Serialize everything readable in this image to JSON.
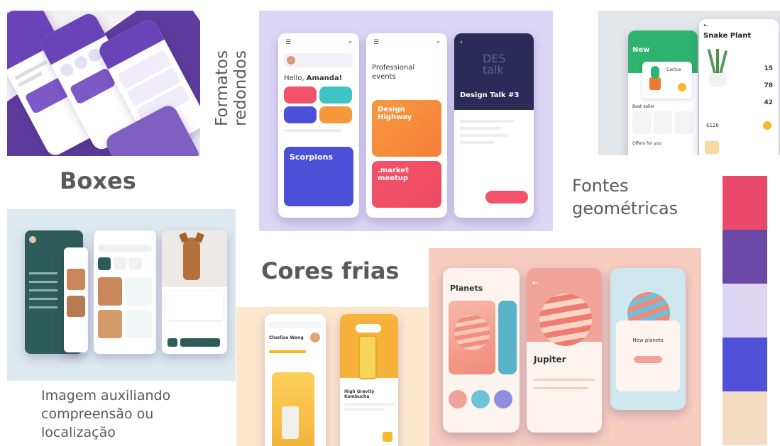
{
  "labels": {
    "formatos_line1": "Formatos",
    "formatos_line2": "redondos",
    "boxes": "Boxes",
    "fontes_line1": "Fontes",
    "fontes_line2": "geométricas",
    "cores_frias": "Cores frias",
    "imagem_line1": "Imagem auxiliando",
    "imagem_line2": "compreensão ou",
    "imagem_line3": "localização"
  },
  "events_app": {
    "hello_prefix": "Hello, ",
    "hello_name": "Amanda!",
    "scorpions": "Scorpions",
    "professional": "Professional",
    "events": "events",
    "design_highway": "Design Highway",
    "market_meetup": ".market meetup",
    "des": "DES",
    "talk": "talk",
    "design_talk": "Design Talk #3"
  },
  "plant_app": {
    "new_tab": "New",
    "cactus": "Cactus",
    "best_seller": "Best seller",
    "offers": "Offers for you",
    "snake_plant": "Snake Plant",
    "stat1": "15",
    "stat2": "78",
    "stat3": "42",
    "price": "$126"
  },
  "drink_app": {
    "user_name": "Charlise Wong",
    "product": "High Gravity Kombucha"
  },
  "planet_app": {
    "planets_title": "Planets",
    "jupiter": "Jupiter",
    "new_planets": "New planets"
  },
  "palette": [
    "#e94a6a",
    "#6a4aa6",
    "#dcd6f2",
    "#4f52d8",
    "#f3dcc2"
  ],
  "colors": {
    "purple": "#6a43b8",
    "teal": "#2e5c58",
    "coral": "#f2536a",
    "orange": "#f6993d",
    "blue": "#4a50d8",
    "green": "#2fb36e",
    "yellow": "#f7b928"
  }
}
